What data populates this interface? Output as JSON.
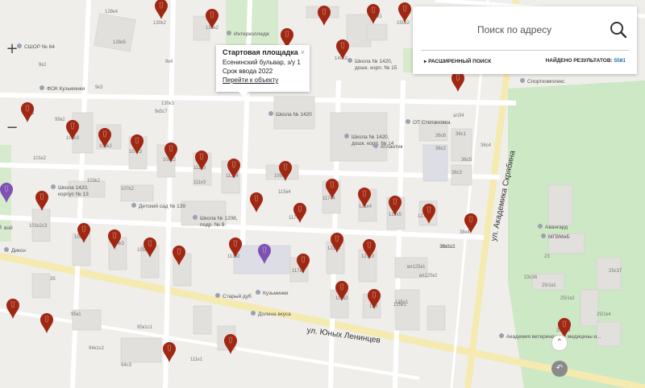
{
  "map": {
    "streets": [
      {
        "name": "ул. Юных Ленинцев",
        "angle": 8
      },
      {
        "name": "ул. Академика Скрябина",
        "angle": -78
      }
    ],
    "buildings": [
      "128к4",
      "130к2",
      "138к2",
      "146к1",
      "150к2",
      "128к5",
      "140к2",
      "9к2",
      "130к3",
      "9к3",
      "9к5с7",
      "9к4",
      "99к1",
      "99к2",
      "101к2",
      "103к3",
      "105к2",
      "107к3",
      "109к2",
      "111к3",
      "113к4",
      "109к4",
      "103к2",
      "107к2",
      "111к3",
      "115к4",
      "117к4",
      "121к4",
      "121к5",
      "127к2",
      "101к2с3",
      "109к3",
      "103к4",
      "105к4",
      "117к3",
      "121к3",
      "125к1",
      "127к3",
      "113к2",
      "117к2",
      "38к1с2",
      "38к4",
      "35",
      "95к1",
      "95к1с1",
      "94к1с2",
      "94с3",
      "111к1",
      "119к2",
      "123",
      "125с1",
      "25/1к2",
      "25/1к4",
      "25/1к3",
      "25с37",
      "23с36",
      "23",
      "36с1",
      "36с2",
      "36с3",
      "36с4",
      "36с5",
      "36с6",
      "25/1к1",
      "38к1с1",
      "ал34",
      "вл125к1",
      "вл125к2"
    ],
    "pois": [
      "Интерколледж",
      "Школа № 1420, дошк. корп. № 15",
      "Школа № 1420",
      "Школа № 1420, дошк. корп. № 14",
      "ОТ Степановка",
      "Атлантик",
      "Спорткомплекс",
      "СШОР № 64",
      "ФОК Кузьминки",
      "Школа 1420, корпус № 13",
      "Детский сад № 139",
      "Школа № 1208, подр. № 9",
      "Старый дуб",
      "Кузьминки",
      "Долина вкуса",
      "Диксн",
      "Авангард",
      "МГВМиБ",
      "Академия ветеринарной медицины и...",
      "вой"
    ]
  },
  "popup": {
    "title": "Стартовая площадка",
    "address": "Есенинский бульвар, з/у 1",
    "deadline": "Срок ввода 2022",
    "link": "Перейти к объекту",
    "close": "×"
  },
  "search": {
    "placeholder": "Поиск по адресу",
    "advanced": "РАСШИРЕННЫЙ ПОИСК",
    "found_label": "НАЙДЕНО РЕЗУЛЬТАТОВ:",
    "found_count": "5581"
  },
  "controls": {
    "zoom_in": "+",
    "zoom_out": "−",
    "up": "⌃",
    "back": "↶"
  },
  "colors": {
    "marker": "#a02712",
    "marker_selected": "#7e52b3",
    "park": "#cde8c5",
    "road": "#ffffff",
    "avenue": "#f5eab0"
  }
}
